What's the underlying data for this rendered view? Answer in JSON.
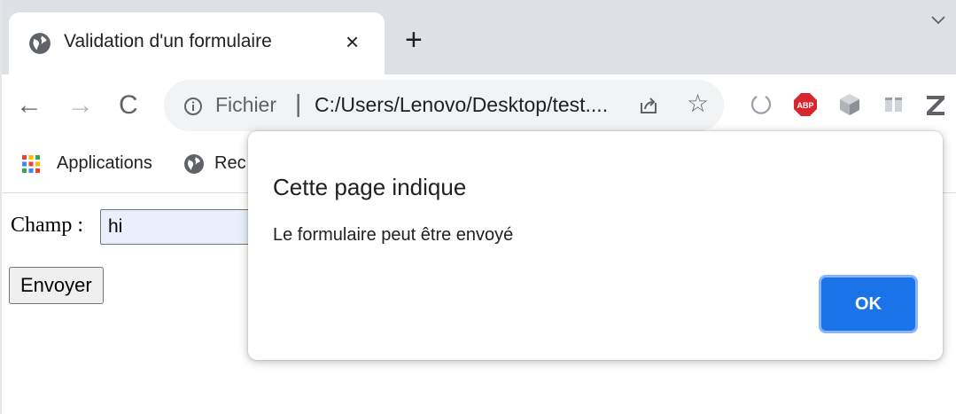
{
  "tab": {
    "title": "Validation d'un formulaire",
    "close_glyph": "×",
    "new_tab_glyph": "+",
    "icon": "globe-icon"
  },
  "toolbar": {
    "back_glyph": "←",
    "forward_glyph": "→",
    "reload_glyph": "C",
    "star_glyph": "☆"
  },
  "omnibox": {
    "scheme_label": "Fichier",
    "separator": "|",
    "url": "C:/Users/Lenovo/Desktop/test...."
  },
  "extensions": [
    {
      "name": "circle-extension-icon"
    },
    {
      "name": "adblock-plus-icon",
      "label": "ABP",
      "color": "#d8262e"
    },
    {
      "name": "cube-extension-icon"
    },
    {
      "name": "reader-extension-icon"
    },
    {
      "name": "z-extension-icon"
    }
  ],
  "bookmarks": {
    "apps_label": "Applications",
    "item_label": "Rec"
  },
  "form": {
    "field_label": "Champ :",
    "field_value": "hi",
    "submit_label": "Envoyer"
  },
  "dialog": {
    "title": "Cette page indique",
    "message": "Le formulaire peut être envoyé",
    "ok_label": "OK"
  },
  "colors": {
    "accent": "#1a73e8",
    "tabstrip": "#dee1e6",
    "omnibox": "#f1f3f4",
    "input_autofill": "#e8f0fe"
  }
}
